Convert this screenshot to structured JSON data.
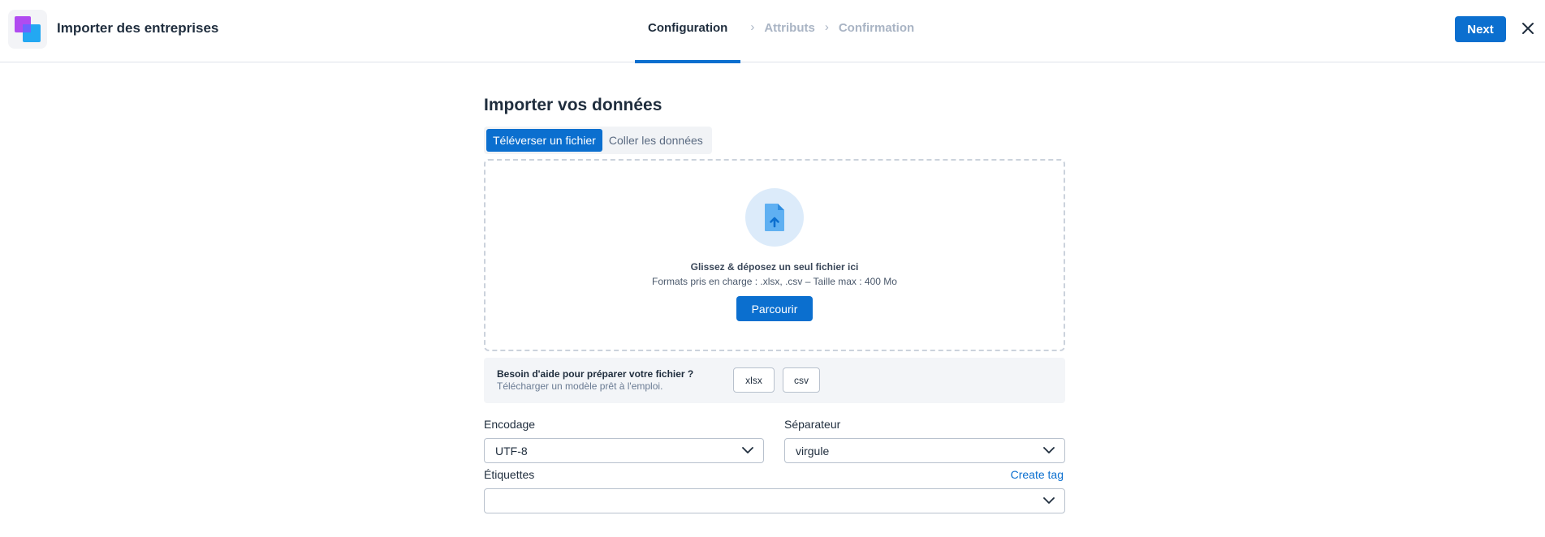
{
  "header": {
    "title": "Importer des entreprises",
    "steps": [
      {
        "label": "Configuration",
        "active": true
      },
      {
        "label": "Attributs",
        "active": false
      },
      {
        "label": "Confirmation",
        "active": false
      }
    ],
    "next_label": "Next",
    "close_icon": "close-icon"
  },
  "main": {
    "title": "Importer vos données",
    "tabs": [
      {
        "label": "Téléverser un fichier",
        "active": true
      },
      {
        "label": "Coller les données",
        "active": false
      }
    ],
    "dropzone": {
      "icon": "file-upload-icon",
      "title": "Glissez & déposez un seul fichier ici",
      "formats": "Formats pris en charge : .xlsx, .csv – Taille max : 400 Mo",
      "browse_label": "Parcourir"
    },
    "help": {
      "title": "Besoin d'aide pour préparer votre fichier ?",
      "subtitle": "Télécharger un modèle prêt à l'emploi.",
      "template_buttons": [
        "xlsx",
        "csv"
      ]
    },
    "encoding": {
      "label": "Encodage",
      "value": "UTF-8"
    },
    "separator": {
      "label": "Séparateur",
      "value": "virgule"
    },
    "tags": {
      "label": "Étiquettes",
      "value": "",
      "create_label": "Create tag"
    }
  },
  "colors": {
    "accent": "#0b6fcf",
    "text": "#1f2d3d",
    "muted": "#a9b4c4"
  }
}
